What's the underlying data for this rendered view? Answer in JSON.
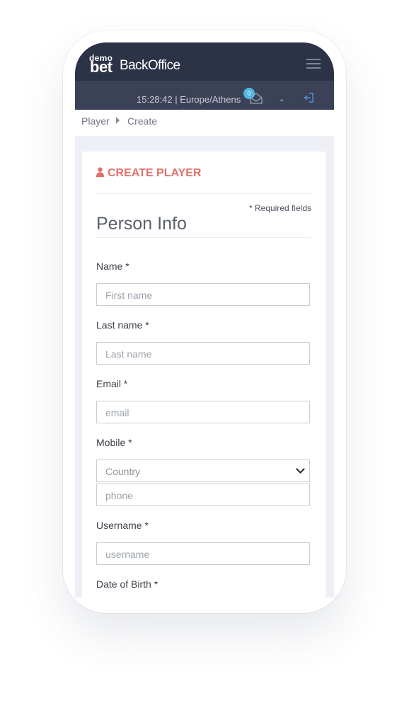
{
  "brand": {
    "demo": "demo",
    "bet": "bet",
    "backoffice": "BackOffice"
  },
  "status": {
    "clock": "15:28:42 | Europe/Athens",
    "mail_count": "0"
  },
  "breadcrumb": {
    "items": [
      "Player",
      "Create"
    ]
  },
  "card": {
    "title": "CREATE PLAYER",
    "required_note": "* Required fields",
    "section": "Person Info"
  },
  "form": {
    "name": {
      "label": "Name *",
      "placeholder": "First name"
    },
    "last_name": {
      "label": "Last name *",
      "placeholder": "Last name"
    },
    "email": {
      "label": "Email *",
      "placeholder": "email"
    },
    "mobile": {
      "label": "Mobile *",
      "country": "Country",
      "phone_placeholder": "phone"
    },
    "username": {
      "label": "Username *",
      "placeholder": "username"
    },
    "dob": {
      "label": "Date of Birth *"
    }
  },
  "colors": {
    "topbar": "#2d3347",
    "subbar": "#3b4257",
    "accent": "#e0706a",
    "badge": "#52b8e0"
  },
  "icons": [
    "menu-icon",
    "mail-icon",
    "chevron-down-icon",
    "logout-icon",
    "user-icon",
    "caret-right-icon"
  ]
}
